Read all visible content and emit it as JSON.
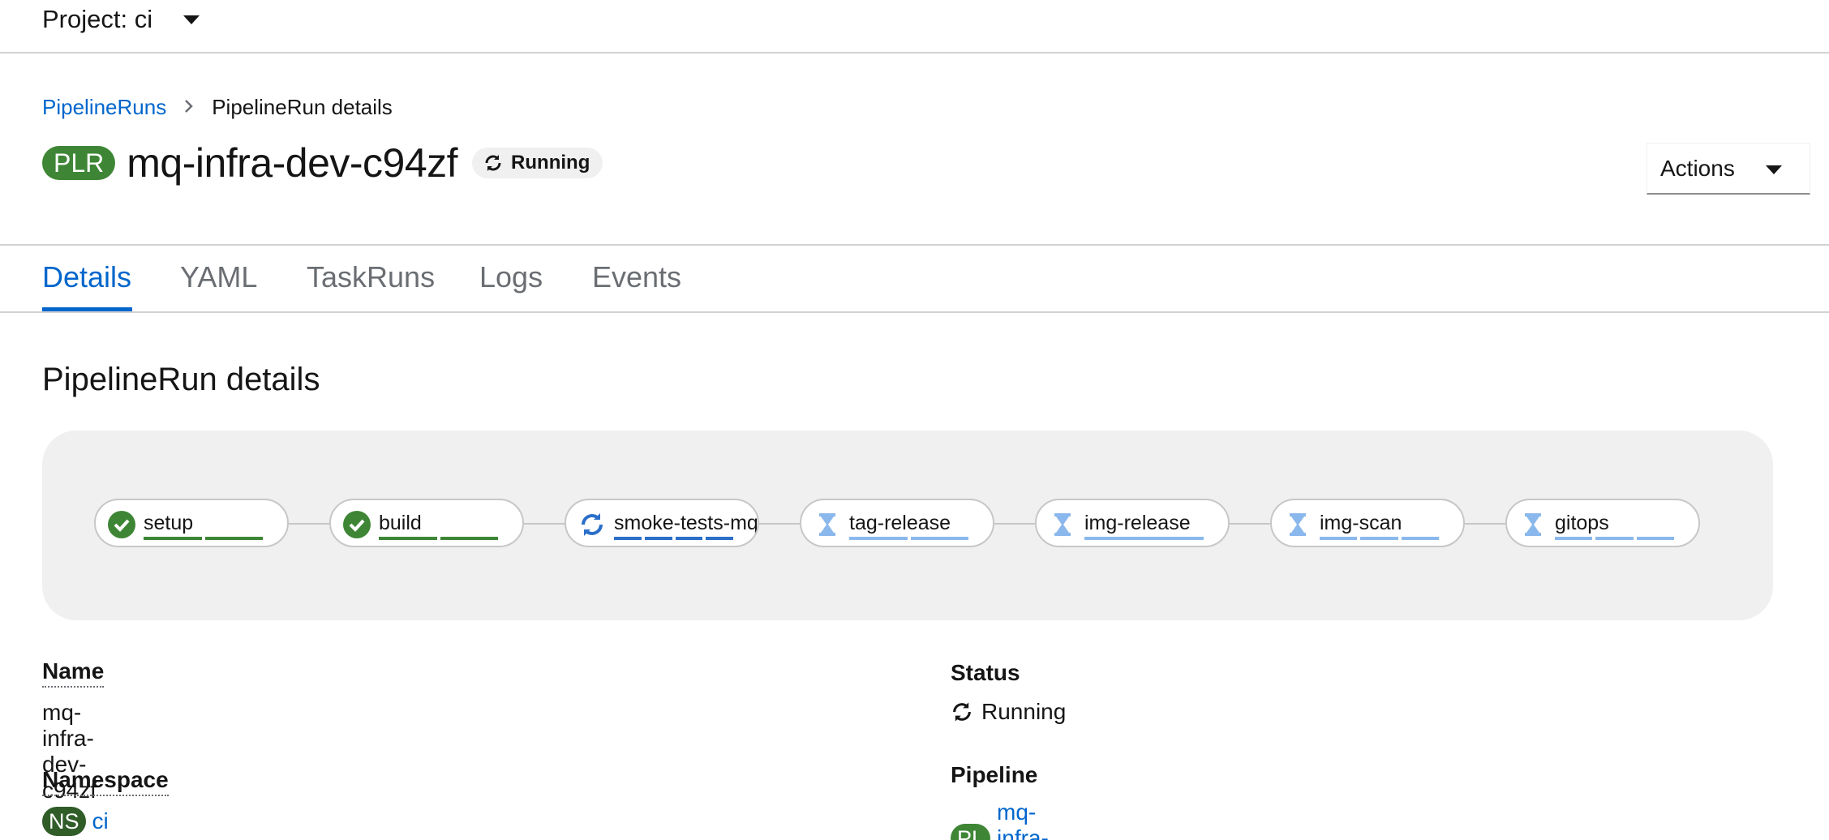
{
  "project_bar": {
    "label": "Project: ci"
  },
  "breadcrumb": {
    "parent": "PipelineRuns",
    "current": "PipelineRun details"
  },
  "header": {
    "badge": "PLR",
    "title": "mq-infra-dev-c94zf",
    "status": "Running",
    "actions_label": "Actions"
  },
  "tabs": [
    "Details",
    "YAML",
    "TaskRuns",
    "Logs",
    "Events"
  ],
  "active_tab": "Details",
  "section_title": "PipelineRun details",
  "pipeline": {
    "tasks": [
      {
        "name": "setup",
        "state": "succeeded",
        "steps": 2
      },
      {
        "name": "build",
        "state": "succeeded",
        "steps": 2
      },
      {
        "name": "smoke-tests-mq",
        "state": "running",
        "steps": 4
      },
      {
        "name": "tag-release",
        "state": "pending",
        "steps": 2
      },
      {
        "name": "img-release",
        "state": "pending",
        "steps": 1
      },
      {
        "name": "img-scan",
        "state": "pending",
        "steps": 3
      },
      {
        "name": "gitops",
        "state": "pending",
        "steps": 3
      }
    ],
    "colors": {
      "succeeded": "#3e8635",
      "running": "#2b6fc9",
      "pending": "#8bb8ec"
    }
  },
  "details": {
    "name_label": "Name",
    "name_value": "mq-infra-dev-c94zf",
    "namespace_label": "Namespace",
    "namespace_badge": "NS",
    "namespace_value": "ci",
    "status_label": "Status",
    "status_value": "Running",
    "pipeline_label": "Pipeline",
    "pipeline_badge": "PL",
    "pipeline_value": "mq-infra-dev"
  }
}
